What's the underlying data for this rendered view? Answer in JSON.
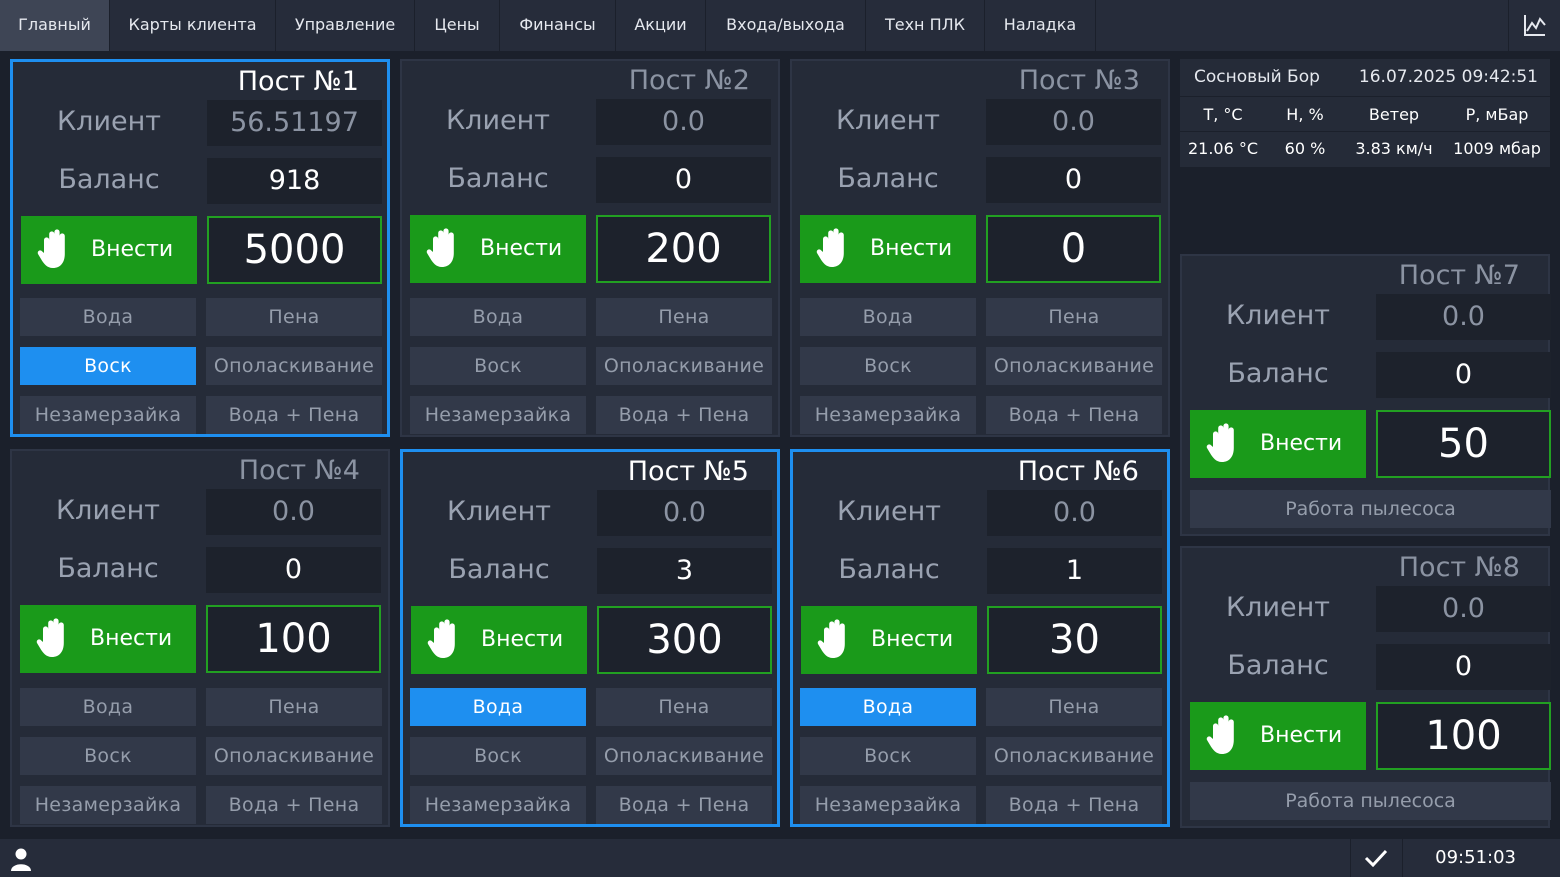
{
  "nav": {
    "tabs": [
      "Главный",
      "Карты клиента",
      "Управление",
      "Цены",
      "Финансы",
      "Акции",
      "Входа/выхода",
      "Техн ПЛК",
      "Наладка"
    ],
    "active_tab": "Главный",
    "chart_icon": "chart-icon"
  },
  "labels": {
    "client": "Клиент",
    "balance": "Баланс",
    "deposit": "Внести",
    "vacuum": "Работа пылесоса"
  },
  "modes": [
    "Вода",
    "Пена",
    "Воск",
    "Ополаскивание",
    "Незамерзайка",
    "Вода + Пена"
  ],
  "posts": [
    {
      "title": "Пост №1",
      "client": "56.51197",
      "balance": "918",
      "amount": "5000",
      "selected": true,
      "active_mode": "Воск"
    },
    {
      "title": "Пост №2",
      "client": "0.0",
      "balance": "0",
      "amount": "200",
      "selected": false,
      "active_mode": ""
    },
    {
      "title": "Пост №3",
      "client": "0.0",
      "balance": "0",
      "amount": "0",
      "selected": false,
      "active_mode": ""
    },
    {
      "title": "Пост №4",
      "client": "0.0",
      "balance": "0",
      "amount": "100",
      "selected": false,
      "active_mode": ""
    },
    {
      "title": "Пост №5",
      "client": "0.0",
      "balance": "3",
      "amount": "300",
      "selected": true,
      "active_mode": "Вода"
    },
    {
      "title": "Пост №6",
      "client": "0.0",
      "balance": "1",
      "amount": "30",
      "selected": true,
      "active_mode": "Вода"
    }
  ],
  "vacuum_posts": [
    {
      "title": "Пост №7",
      "client": "0.0",
      "balance": "0",
      "amount": "50"
    },
    {
      "title": "Пост №8",
      "client": "0.0",
      "balance": "0",
      "amount": "100"
    }
  ],
  "weather": {
    "location": "Сосновый Бор",
    "datetime": "16.07.2025 09:42:51",
    "headers": [
      "T, °C",
      "H, %",
      "Ветер",
      "P, мБар"
    ],
    "values": [
      "21.06 °C",
      "60 %",
      "3.83 км/ч",
      "1009 мбар"
    ]
  },
  "status": {
    "time": "09:51:03",
    "user_icon": "user-icon",
    "ok_icon": "checkmark-icon"
  },
  "colors": {
    "accent_blue": "#1e8ff0",
    "deposit_green": "#1a9a1a",
    "background": "#1b202b",
    "panel": "#252b38"
  }
}
